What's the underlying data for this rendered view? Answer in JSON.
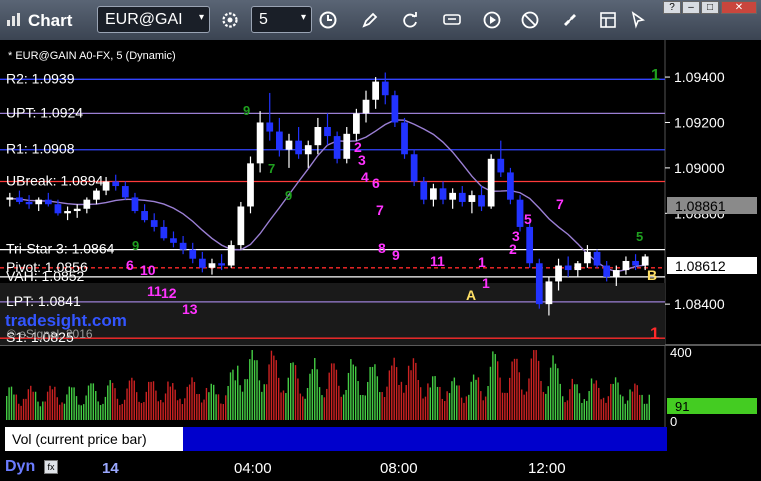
{
  "window": {
    "title": "Chart",
    "symbol": "EUR@GAI",
    "interval": "5",
    "controls": [
      "?",
      "–",
      "□",
      "✕"
    ]
  },
  "chart_header": "* EUR@GAIN A0-FX, 5 (Dynamic)",
  "watermark": {
    "site": "tradesight.com",
    "copyright": "© eSignal, 2016"
  },
  "chart_data": {
    "type": "candlestick",
    "symbol": "EUR@GAIN A0-FX",
    "interval": "5 min",
    "y_ticks": [
      "1.09400",
      "1.09200",
      "1.09000",
      "1.08800",
      "1.08400"
    ],
    "ylim": [
      1.0822,
      1.0955
    ],
    "x_ticks": [
      "14",
      "04:00",
      "08:00",
      "12:00"
    ],
    "last_price": "1.08612",
    "ma_value": "1.08861",
    "volume_last": "91",
    "volume_axis": [
      "400",
      "0"
    ],
    "levels": [
      {
        "label": "R2: 1.0939",
        "value": 1.0939,
        "color": "#3344ff"
      },
      {
        "label": "UPT: 1.0924",
        "value": 1.0924,
        "color": "#9b7fd4"
      },
      {
        "label": "R1: 1.0908",
        "value": 1.0908,
        "color": "#3344ff"
      },
      {
        "label": "UBreak: 1.0894",
        "value": 1.0894,
        "color": "#ff3b3b"
      },
      {
        "label": "Tri-Star 3: 1.0864",
        "value": 1.0864,
        "color": "#ffffff"
      },
      {
        "label": "Pivot: 1.0856",
        "value": 1.0856,
        "color": "#ff2a2a"
      },
      {
        "label": "VAH: 1.0852",
        "value": 1.0852,
        "color": "#ffffff"
      },
      {
        "label": "LPT: 1.0841",
        "value": 1.0841,
        "color": "#9b7fd4"
      },
      {
        "label": "S1: 1.0825",
        "value": 1.0825,
        "color": "#ff2a2a"
      }
    ],
    "candles": [
      [
        1.0886,
        1.0889,
        1.0883,
        1.0887
      ],
      [
        1.0887,
        1.089,
        1.0884,
        1.0885
      ],
      [
        1.0885,
        1.0888,
        1.0882,
        1.0884
      ],
      [
        1.0884,
        1.0887,
        1.0881,
        1.0886
      ],
      [
        1.0886,
        1.0889,
        1.0883,
        1.0884
      ],
      [
        1.0884,
        1.0886,
        1.0879,
        1.088
      ],
      [
        1.088,
        1.0883,
        1.0877,
        1.0881
      ],
      [
        1.0881,
        1.0884,
        1.0878,
        1.0882
      ],
      [
        1.0882,
        1.0887,
        1.088,
        1.0886
      ],
      [
        1.0886,
        1.0891,
        1.0884,
        1.089
      ],
      [
        1.089,
        1.0896,
        1.0888,
        1.0894
      ],
      [
        1.0894,
        1.0897,
        1.089,
        1.0892
      ],
      [
        1.0892,
        1.0894,
        1.0886,
        1.0887
      ],
      [
        1.0887,
        1.0889,
        1.088,
        1.0881
      ],
      [
        1.0881,
        1.0884,
        1.0876,
        1.0877
      ],
      [
        1.0877,
        1.088,
        1.0872,
        1.0874
      ],
      [
        1.0874,
        1.0877,
        1.0868,
        1.0869
      ],
      [
        1.0869,
        1.0872,
        1.0865,
        1.0867
      ],
      [
        1.0867,
        1.087,
        1.0862,
        1.0864
      ],
      [
        1.0864,
        1.0867,
        1.0858,
        1.086
      ],
      [
        1.086,
        1.0863,
        1.0854,
        1.0856
      ],
      [
        1.0856,
        1.086,
        1.0853,
        1.0858
      ],
      [
        1.0858,
        1.0862,
        1.0855,
        1.0857
      ],
      [
        1.0857,
        1.0868,
        1.0856,
        1.0866
      ],
      [
        1.0866,
        1.0885,
        1.0864,
        1.0883
      ],
      [
        1.0883,
        1.0905,
        1.088,
        1.0902
      ],
      [
        1.0902,
        1.0925,
        1.0898,
        1.092
      ],
      [
        1.092,
        1.0933,
        1.0912,
        1.0916
      ],
      [
        1.0916,
        1.0922,
        1.0905,
        1.0908
      ],
      [
        1.0908,
        1.0915,
        1.09,
        1.0912
      ],
      [
        1.0912,
        1.0918,
        1.0904,
        1.0906
      ],
      [
        1.0906,
        1.0912,
        1.09,
        1.091
      ],
      [
        1.091,
        1.0922,
        1.0906,
        1.0918
      ],
      [
        1.0918,
        1.0924,
        1.091,
        1.0914
      ],
      [
        1.0914,
        1.0916,
        1.0902,
        1.0904
      ],
      [
        1.0904,
        1.0918,
        1.0902,
        1.0915
      ],
      [
        1.0915,
        1.0926,
        1.0912,
        1.0924
      ],
      [
        1.0924,
        1.0934,
        1.092,
        1.093
      ],
      [
        1.093,
        1.094,
        1.0926,
        1.0938
      ],
      [
        1.0938,
        1.0942,
        1.0928,
        1.0932
      ],
      [
        1.0932,
        1.0934,
        1.0918,
        1.092
      ],
      [
        1.092,
        1.0922,
        1.0904,
        1.0906
      ],
      [
        1.0906,
        1.0908,
        1.0892,
        1.0894
      ],
      [
        1.0894,
        1.0896,
        1.0884,
        1.0886
      ],
      [
        1.0886,
        1.0893,
        1.0883,
        1.0891
      ],
      [
        1.0891,
        1.0894,
        1.0884,
        1.0886
      ],
      [
        1.0886,
        1.0891,
        1.0882,
        1.0889
      ],
      [
        1.0889,
        1.0892,
        1.0883,
        1.0885
      ],
      [
        1.0885,
        1.089,
        1.088,
        1.0888
      ],
      [
        1.0888,
        1.0892,
        1.0881,
        1.0883
      ],
      [
        1.0883,
        1.0906,
        1.0882,
        1.0904
      ],
      [
        1.0904,
        1.0912,
        1.0896,
        1.0898
      ],
      [
        1.0898,
        1.09,
        1.0884,
        1.0886
      ],
      [
        1.0886,
        1.0888,
        1.0872,
        1.0874
      ],
      [
        1.0874,
        1.0876,
        1.0856,
        1.0858
      ],
      [
        1.0858,
        1.086,
        1.0838,
        1.084
      ],
      [
        1.084,
        1.0852,
        1.0835,
        1.085
      ],
      [
        1.085,
        1.086,
        1.0846,
        1.0857
      ],
      [
        1.0857,
        1.0861,
        1.0852,
        1.0855
      ],
      [
        1.0855,
        1.0859,
        1.0852,
        1.0858
      ],
      [
        1.0858,
        1.0866,
        1.0856,
        1.0863
      ],
      [
        1.0863,
        1.0864,
        1.0856,
        1.0857
      ],
      [
        1.0857,
        1.0859,
        1.085,
        1.0852
      ],
      [
        1.0852,
        1.0857,
        1.0848,
        1.0855
      ],
      [
        1.0855,
        1.0861,
        1.0853,
        1.0859
      ],
      [
        1.0859,
        1.0862,
        1.0855,
        1.0857
      ],
      [
        1.0857,
        1.0862,
        1.0855,
        1.0861
      ]
    ]
  },
  "bottom": {
    "indicator_label": "Vol (current price bar)",
    "close_glyph": "×",
    "dynamic_label": "Dyn",
    "fx_label": "fx"
  }
}
